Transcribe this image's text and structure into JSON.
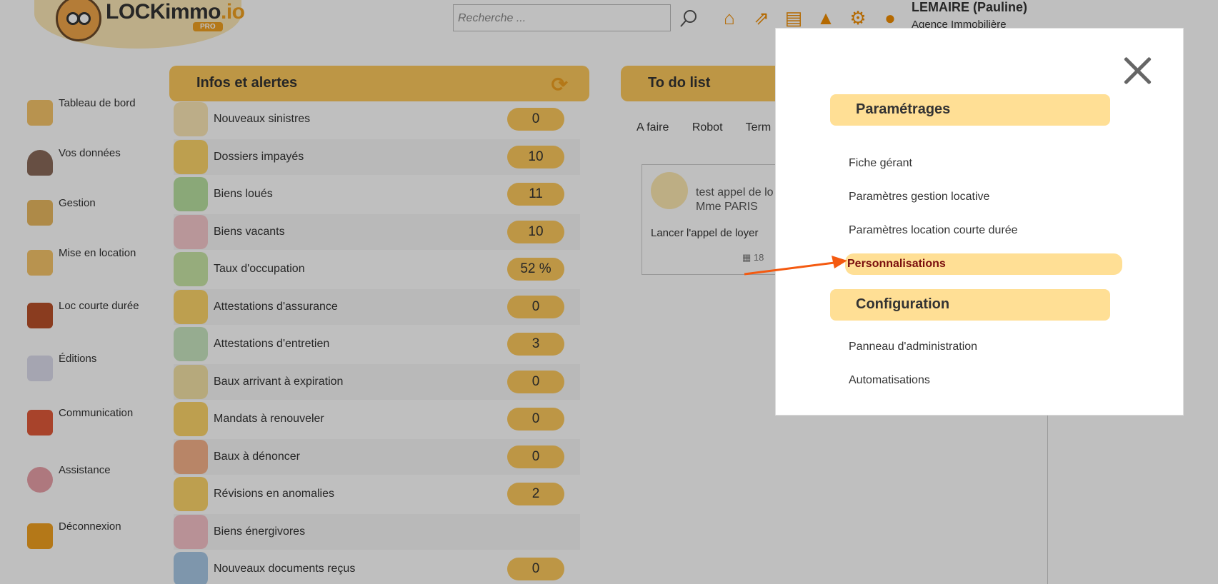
{
  "header": {
    "logo_text": "LOCKimmo",
    "logo_suffix": ".io",
    "logo_badge": "PRO",
    "search_placeholder": "Recherche ...",
    "user_name": "LEMAIRE (Pauline)",
    "user_agency": "Agence Immobilière",
    "icons": [
      "home-icon",
      "external-link-icon",
      "document-icon",
      "alert-triangle-icon",
      "gear-icon",
      "user-icon"
    ]
  },
  "sidebar": {
    "items": [
      {
        "label": "Tableau de bord",
        "icon": "dashboard-icon"
      },
      {
        "label": "Vos données",
        "icon": "person-icon"
      },
      {
        "label": "Gestion",
        "icon": "management-icon"
      },
      {
        "label": "Mise en location",
        "icon": "rental-icon"
      },
      {
        "label": "Loc courte durée",
        "icon": "suitcase-icon"
      },
      {
        "label": "Éditions",
        "icon": "report-icon"
      },
      {
        "label": "Communication",
        "icon": "chat-icon"
      },
      {
        "label": "Assistance",
        "icon": "support-icon"
      },
      {
        "label": "Déconnexion",
        "icon": "logout-icon"
      }
    ]
  },
  "alerts_panel": {
    "title": "Infos et alertes",
    "rows": [
      {
        "label": "Nouveaux sinistres",
        "count": "0",
        "icon": "warning-icon",
        "color": "#fbe7b6"
      },
      {
        "label": "Dossiers impayés",
        "count": "10",
        "icon": "unpaid-icon",
        "color": "#fcd46a"
      },
      {
        "label": "Biens loués",
        "count": "11",
        "icon": "house-people-icon",
        "color": "#b8e0a0"
      },
      {
        "label": "Biens vacants",
        "count": "10",
        "icon": "house-key-icon",
        "color": "#f6c8cc"
      },
      {
        "label": "Taux d'occupation",
        "count": "52 %",
        "icon": "occupancy-icon",
        "color": "#c9e6a6"
      },
      {
        "label": "Attestations d'assurance",
        "count": "0",
        "icon": "insurance-icon",
        "color": "#fcd46a"
      },
      {
        "label": "Attestations d'entretien",
        "count": "3",
        "icon": "maintenance-icon",
        "color": "#c9e6c0"
      },
      {
        "label": "Baux arrivant à expiration",
        "count": "0",
        "icon": "building-icon",
        "color": "#f3e2a6"
      },
      {
        "label": "Mandats à renouveler",
        "count": "0",
        "icon": "mandate-icon",
        "color": "#fcd46a"
      },
      {
        "label": "Baux à dénoncer",
        "count": "0",
        "icon": "lease-icon",
        "color": "#f6b28a"
      },
      {
        "label": "Révisions en anomalies",
        "count": "2",
        "icon": "calculator-icon",
        "color": "#fcd46a"
      },
      {
        "label": "Biens énergivores",
        "count": "",
        "icon": "energy-icon",
        "color": "#f6c2c8"
      },
      {
        "label": "Nouveaux documents reçus",
        "count": "0",
        "icon": "download-icon",
        "color": "#a8c8e6"
      }
    ]
  },
  "todo_panel": {
    "title": "To do list",
    "tabs": [
      "A faire",
      "Robot",
      "Term"
    ],
    "card": {
      "title": "test appel de lo",
      "subtitle": "Mme PARIS",
      "action": "Lancer l'appel de loyer",
      "date": "18"
    }
  },
  "modal": {
    "sections": [
      {
        "title": "Paramétrages",
        "links": [
          {
            "label": "Fiche gérant",
            "active": false
          },
          {
            "label": "Paramètres gestion locative",
            "active": false
          },
          {
            "label": "Paramètres location courte durée",
            "active": false
          },
          {
            "label": "Personnalisations",
            "active": true
          }
        ]
      },
      {
        "title": "Configuration",
        "links": [
          {
            "label": "Panneau d'administration",
            "active": false
          },
          {
            "label": "Automatisations",
            "active": false
          }
        ]
      }
    ]
  },
  "colors": {
    "accent": "#fcc85c",
    "section_bg": "#ffdf95",
    "active_text": "#7a0e0e",
    "arrow": "#f45a10"
  }
}
